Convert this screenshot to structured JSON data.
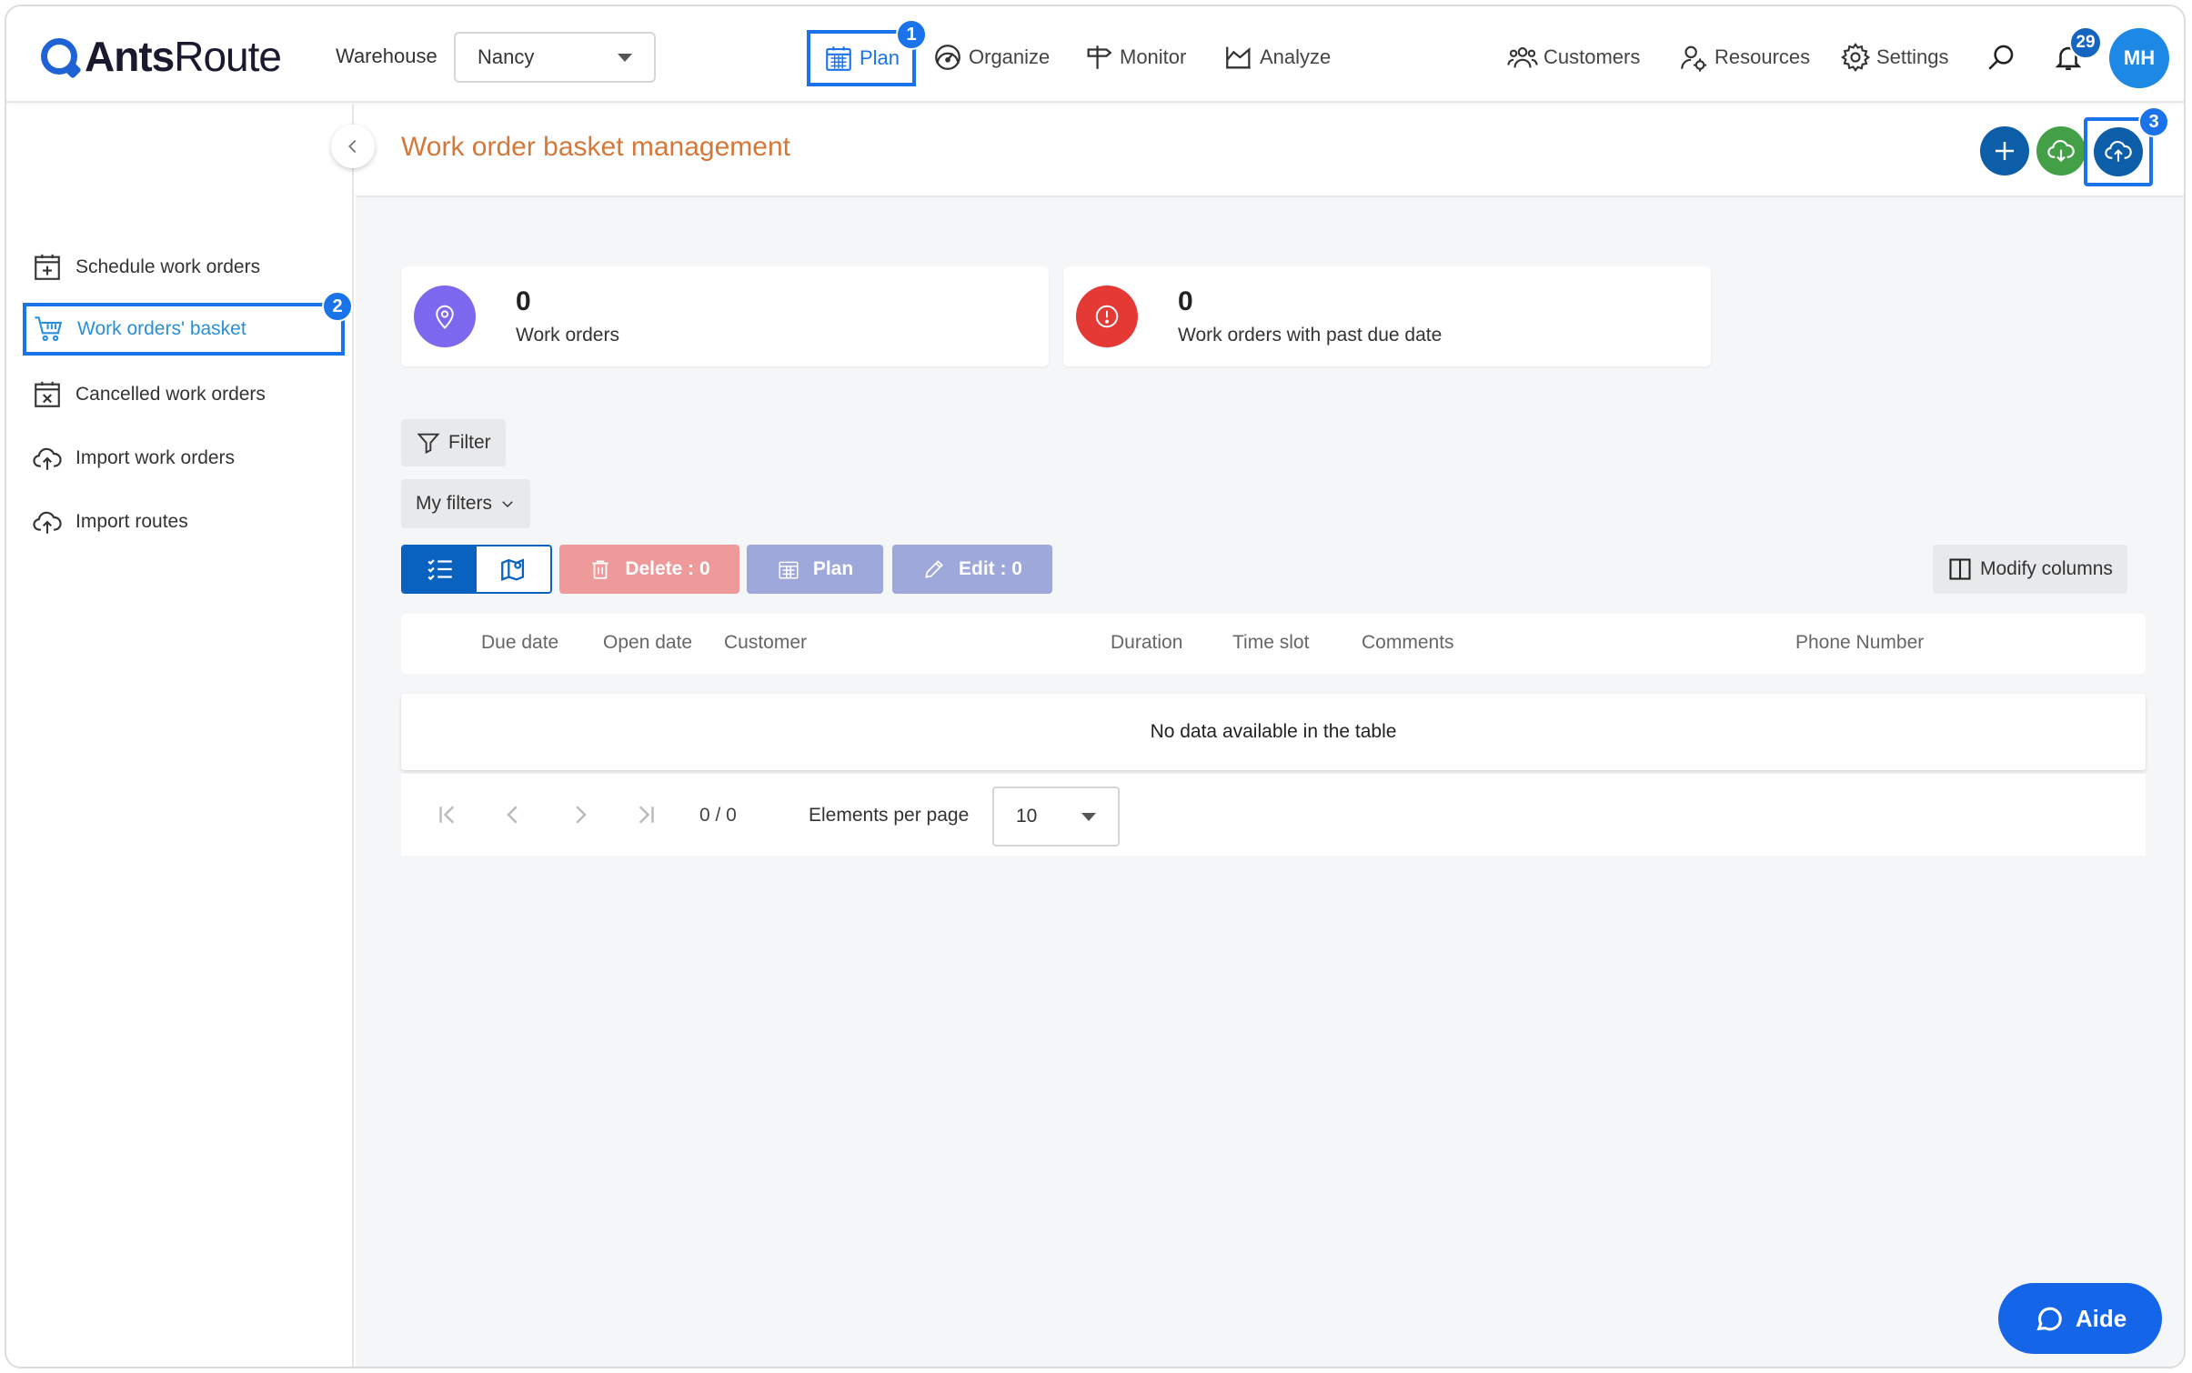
{
  "app": {
    "logo_bold": "Ants",
    "logo_light": "Route"
  },
  "topnav": {
    "warehouse_label": "Warehouse",
    "warehouse_value": "Nancy",
    "plan": "Plan",
    "organize": "Organize",
    "monitor": "Monitor",
    "analyze": "Analyze",
    "customers": "Customers",
    "resources": "Resources",
    "settings": "Settings",
    "notification_count": "29",
    "avatar_initials": "MH"
  },
  "callouts": {
    "one": "1",
    "two": "2",
    "three": "3"
  },
  "sidebar": {
    "items": [
      {
        "label": "Schedule work orders"
      },
      {
        "label": "Work orders' basket"
      },
      {
        "label": "Cancelled work orders"
      },
      {
        "label": "Import work orders"
      },
      {
        "label": "Import routes"
      }
    ]
  },
  "header": {
    "title": "Work order basket management"
  },
  "stats": {
    "work_orders": {
      "value": "0",
      "label": "Work orders"
    },
    "past_due": {
      "value": "0",
      "label": "Work orders with past due date"
    }
  },
  "toolbar": {
    "filter": "Filter",
    "my_filters": "My filters",
    "delete": "Delete : 0",
    "plan": "Plan",
    "edit": "Edit : 0",
    "modify_columns": "Modify columns"
  },
  "table": {
    "columns": [
      "Due date",
      "Open date",
      "Customer",
      "Duration",
      "Time slot",
      "Comments",
      "Phone Number"
    ],
    "empty": "No data available in the table"
  },
  "pager": {
    "count": "0 / 0",
    "per_page_label": "Elements per page",
    "per_page_value": "10"
  },
  "help": {
    "label": "Aide"
  },
  "colors": {
    "accent": "#1a73e8",
    "title": "#d4783a",
    "delete": "#ef9a9a",
    "plan": "#9fa8da",
    "edit": "#9fa8da"
  }
}
